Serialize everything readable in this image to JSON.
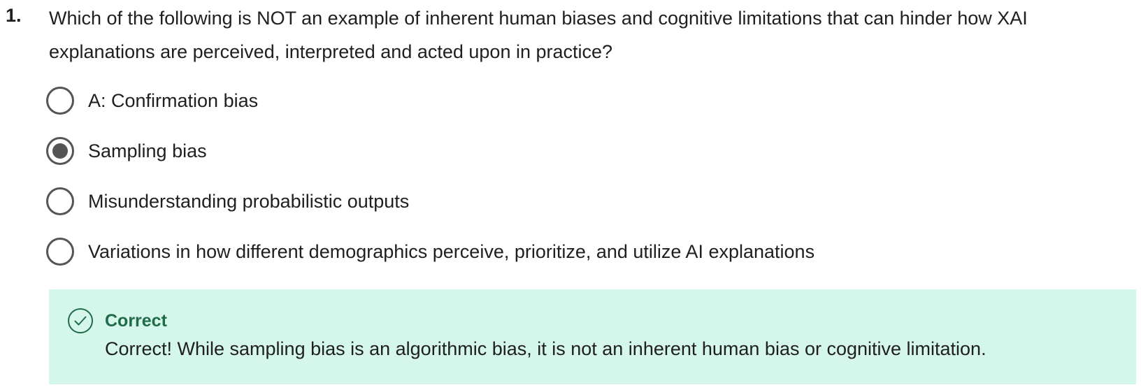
{
  "question": {
    "number": "1.",
    "text": "Which of the following is NOT an example of inherent human biases and cognitive limitations that can hinder how XAI explanations are perceived, interpreted and acted upon in practice?",
    "options": [
      {
        "label": "A: Confirmation bias",
        "selected": false
      },
      {
        "label": "Sampling bias",
        "selected": true
      },
      {
        "label": "Misunderstanding probabilistic outputs",
        "selected": false
      },
      {
        "label": "Variations in how different demographics perceive, prioritize, and utilize AI explanations",
        "selected": false
      }
    ]
  },
  "feedback": {
    "icon": "check-circle-icon",
    "title": "Correct",
    "message": "Correct! While sampling bias is an algorithmic bias, it is not an inherent human bias or cognitive limitation.",
    "background_color": "#d5f6ea",
    "title_color": "#1f6b4a"
  },
  "colors": {
    "radio_border": "#555555",
    "text": "#1f1f1f"
  }
}
